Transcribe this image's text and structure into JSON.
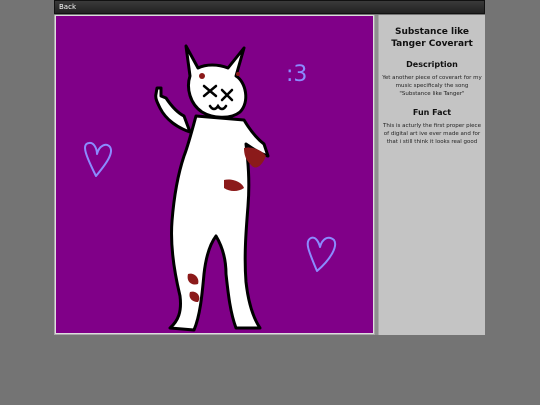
{
  "nav": {
    "back_label": "Back"
  },
  "artwork": {
    "caption_text": ":3",
    "colors": {
      "background": "#800088",
      "figure": "#ffffff",
      "outline": "#000000",
      "blood": "#8b1a1a",
      "doodle": "#8b8bff"
    },
    "icons": [
      "cat-character-drawing",
      "heart-outline-left",
      "heart-outline-right"
    ]
  },
  "info": {
    "title": "Substance like Tanger Coverart",
    "description_heading": "Description",
    "description_text": "Yet another piece of coverart for my music specificaly the song \"Substance like Tanger\"",
    "fun_fact_heading": "Fun Fact",
    "fun_fact_text": "This is acturly the first proper piece of digital art ive ever made and for that i still think it looks real good"
  }
}
